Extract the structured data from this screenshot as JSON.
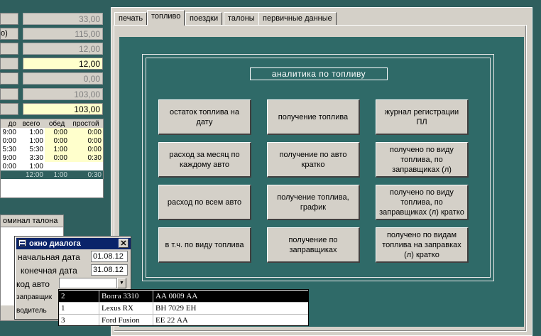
{
  "left": {
    "fields": [
      "33,00",
      "115,00",
      "12,00",
      "12,00",
      "0,00",
      "103,00",
      "103,00"
    ],
    "stubs": [
      "",
      "о)",
      "",
      "",
      "",
      "",
      ""
    ],
    "grid_headers": [
      "до",
      "всего",
      "обед",
      "простой"
    ],
    "grid_rows": [
      [
        "9:00",
        "1:00",
        "0:00",
        "0:00"
      ],
      [
        "0:00",
        "1:00",
        "0:00",
        "0:00"
      ],
      [
        "5:30",
        "5:30",
        "1:00",
        "0:00"
      ],
      [
        "9:00",
        "3:30",
        "0:00",
        "0:30"
      ],
      [
        "0:00",
        "1:00",
        "",
        ""
      ]
    ],
    "grid_totals": [
      "",
      "12:00",
      "1:00",
      "0:30"
    ],
    "coupon_header": "оминал талона"
  },
  "tabs": [
    "печать",
    "топливо",
    "поездки",
    "талоны",
    "первичные данные"
  ],
  "section_title": "аналитика по топливу",
  "buttons": [
    [
      "остаток топлива на дату",
      "получение топлива",
      "журнал регистрации ПЛ"
    ],
    [
      "расход за месяц по каждому авто",
      "получение по авто кратко",
      "получено по виду топлива,  по заправщиках (л)"
    ],
    [
      "расход по всем авто",
      "получение топлива, график",
      "получено по виду топлива,  по заправщиках (л) кратко"
    ],
    [
      "в т.ч. по виду топлива",
      "получение по заправщиках",
      "получено по видам топлива на заправках (л) кратко"
    ]
  ],
  "dialog": {
    "title": "окно диалога",
    "start_label": "начальная дата",
    "start_value": "01.08.12",
    "end_label": "конечная дата",
    "end_value": "31.08.12",
    "car_label": "код авто",
    "car_value": "",
    "refueler_label": "заправщик",
    "driver_label": "водитель"
  },
  "dropdown": [
    {
      "code": "2",
      "model": "Волга 3310",
      "plate": "АА 0009 АА"
    },
    {
      "code": "1",
      "model": "Lexus RX",
      "plate": "ВН 7029 ЕН"
    },
    {
      "code": "3",
      "model": "Ford Fusion",
      "plate": "ЕЕ 22 АА"
    }
  ]
}
